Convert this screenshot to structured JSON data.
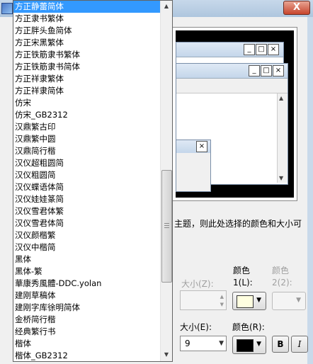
{
  "dialog": {
    "close_glyph": "X",
    "description": "主题，则此处选择的颜色和大小可",
    "size_label_1": "大小(Z):",
    "color_label_1": "颜色\n1(L):",
    "color_label_2": "颜色\n2(2):",
    "size_label_2": "大小(E):",
    "color_label_3": "颜色(R):",
    "size_value": "9",
    "bold_label": "B",
    "italic_label": "I",
    "colors": {
      "color1": "#ffffe0",
      "font_color": "#000000"
    }
  },
  "preview": {
    "min_glyph": "_",
    "max_glyph": "□",
    "close_glyph": "×"
  },
  "font_list": {
    "items": [
      "方正静蕾简体",
      "方正隶书繁体",
      "方正胖头鱼简体",
      "方正宋黑繁体",
      "方正铁筋隶书繁体",
      "方正铁筋隶书简体",
      "方正祥隶繁体",
      "方正祥隶简体",
      "仿宋",
      "仿宋_GB2312",
      "汉鼎繁古印",
      "汉鼎繁中圆",
      "汉鼎简行楷",
      "汉仪超粗圆简",
      "汉仪粗圆简",
      "汉仪蝶语体简",
      "汉仪娃娃篆简",
      "汉仪雪君体繁",
      "汉仪雪君体简",
      "汉仪颜楷繁",
      "汉仪中楷简",
      "黑体",
      "黑体-繁",
      "華康秀風體-DDC.yolan",
      "建刚草稿体",
      "建刚字库徐明简体",
      "金桥简行楷",
      "经典繁行书",
      "楷体",
      "楷体_GB2312"
    ],
    "selected_index": 0
  }
}
